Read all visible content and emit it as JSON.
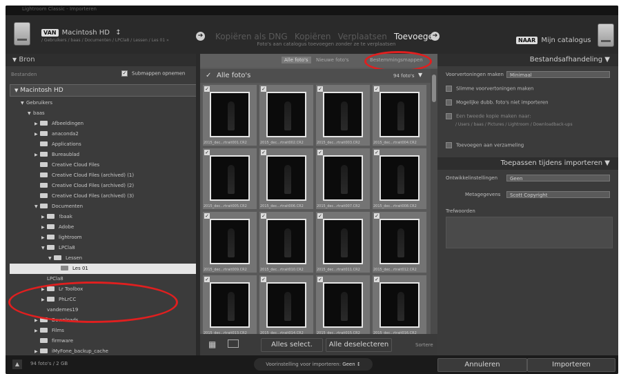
{
  "window": {
    "title": "Lightroom Classic - Importeren"
  },
  "header": {
    "source_tag": "VAN",
    "source_drive": "Macintosh HD",
    "source_path": "/ Gebruikers / baas / Documenten / LPCla8 / Lessen / Les 01 »",
    "modes": [
      "Kopiëren als DNG",
      "Kopiëren",
      "Verplaatsen",
      "Toevoegen"
    ],
    "active_mode": "Toevoegen",
    "mode_subtitle": "Foto's aan catalogus toevoegen zonder ze te verplaatsen",
    "dest_tag": "NAAR",
    "dest_label": "Mijn catalogus"
  },
  "left_panel": {
    "title": "Bron",
    "files_label": "Bestanden",
    "include_subfolders": "Submappen opnemen",
    "volume": "Macintosh HD",
    "tree": [
      {
        "label": "Gebruikers",
        "indent": 1,
        "tri": "▼",
        "folder": false
      },
      {
        "label": "baas",
        "indent": 2,
        "tri": "▼",
        "folder": false
      },
      {
        "label": "Afbeeldingen",
        "indent": 3,
        "tri": "▶",
        "folder": true
      },
      {
        "label": "anaconda2",
        "indent": 3,
        "tri": "▶",
        "folder": true
      },
      {
        "label": "Applications",
        "indent": 3,
        "tri": "",
        "folder": true
      },
      {
        "label": "Bureaublad",
        "indent": 3,
        "tri": "▶",
        "folder": true
      },
      {
        "label": "Creative Cloud Files",
        "indent": 3,
        "tri": "",
        "folder": true
      },
      {
        "label": "Creative Cloud Files (archived) (1)",
        "indent": 3,
        "tri": "",
        "folder": true
      },
      {
        "label": "Creative Cloud Files (archived) (2)",
        "indent": 3,
        "tri": "",
        "folder": true
      },
      {
        "label": "Creative Cloud Files (archived) (3)",
        "indent": 3,
        "tri": "",
        "folder": true
      },
      {
        "label": "Documenten",
        "indent": 3,
        "tri": "▼",
        "folder": true
      },
      {
        "label": "!baak",
        "indent": 4,
        "tri": "▶",
        "folder": true
      },
      {
        "label": "Adobe",
        "indent": 4,
        "tri": "▶",
        "folder": true
      },
      {
        "label": "lightroom",
        "indent": 4,
        "tri": "▶",
        "folder": true
      },
      {
        "label": "LPCla8",
        "indent": 4,
        "tri": "▼",
        "folder": true
      },
      {
        "label": "Lessen",
        "indent": 5,
        "tri": "▼",
        "folder": true
      },
      {
        "label": "Les 01",
        "indent": 6,
        "tri": "",
        "folder": true,
        "selected": true
      },
      {
        "label": "LPCla8",
        "indent": 4,
        "tri": "",
        "folder": false
      },
      {
        "label": "Lr Toolbox",
        "indent": 4,
        "tri": "▶",
        "folder": true
      },
      {
        "label": "PhLrCC",
        "indent": 4,
        "tri": "▶",
        "folder": true
      },
      {
        "label": "vandemes19",
        "indent": 4,
        "tri": "",
        "folder": false
      },
      {
        "label": "Downloads",
        "indent": 3,
        "tri": "▶",
        "folder": true
      },
      {
        "label": "Films",
        "indent": 3,
        "tri": "▶",
        "folder": true
      },
      {
        "label": "firmware",
        "indent": 3,
        "tri": "",
        "folder": true
      },
      {
        "label": "iMyFone_backup_cache",
        "indent": 3,
        "tri": "▶",
        "folder": true
      }
    ]
  },
  "grid": {
    "filter_all": "Alle foto's",
    "filter_new": "Nieuwe foto's",
    "filter_dest": "Bestemmingsmappen",
    "section_title": "Alle foto's",
    "count": "94 foto's",
    "thumbnails": [
      "2015_dec...rtrait001.CR2",
      "2015_dec...rtrait002.CR2",
      "2015_dec...rtrait003.CR2",
      "2015_dec...rtrait004.CR2",
      "2015_dec...rtrait005.CR2",
      "2015_dec...rtrait006.CR2",
      "2015_dec...rtrait007.CR2",
      "2015_dec...rtrait008.CR2",
      "2015_dec...rtrait009.CR2",
      "2015_dec...rtrait010.CR2",
      "2015_dec...rtrait011.CR2",
      "2015_dec...rtrait012.CR2",
      "2015_dec...rtrait013.CR2",
      "2015_dec...rtrait014.CR2",
      "2015_dec...rtrait015.CR2",
      "2015_dec...rtrait016.CR2"
    ],
    "select_all": "Alles select.",
    "deselect_all": "Alle deselecteren",
    "sort_label": "Sortere"
  },
  "right_panel": {
    "title": "Bestandsafhandeling",
    "previews_label": "Voorvertoningen maken",
    "previews_value": "Minimaal",
    "opt_smart": "Slimme voorvertoningen maken",
    "opt_dupes": "Mogelijke dubb. foto's niet importeren",
    "opt_second_copy": "Een tweede kopie maken naar:",
    "second_copy_path": "/ Users / baas / Pictures / Lightroom / Downloadback-ups",
    "opt_collection": "Toevoegen aan verzameling",
    "apply_title": "Toepassen tijdens importeren",
    "develop_label": "Ontwikkelinstellingen",
    "develop_value": "Geen",
    "metadata_label": "Metagegevens",
    "metadata_value": "Scott Copyright",
    "keywords_label": "Trefwoorden"
  },
  "bottom": {
    "status": "94 foto's / 2 GB",
    "preset_label": "Voorinstelling voor importeren:",
    "preset_value": "Geen",
    "cancel": "Annuleren",
    "import": "Importeren"
  }
}
